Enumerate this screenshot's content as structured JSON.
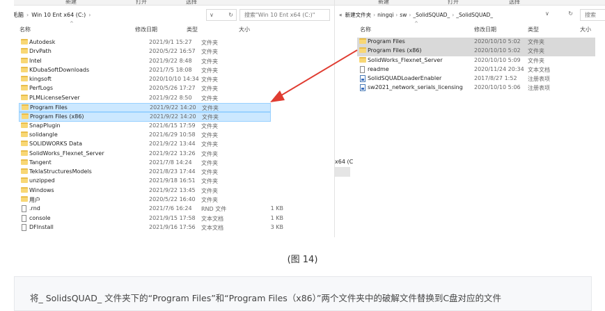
{
  "left": {
    "toolbar": [
      "新建",
      "打开",
      "选择"
    ],
    "address": [
      "毛脑",
      "Win 10 Ent x64 (C:)"
    ],
    "refresh_icon": "refresh-icon",
    "search_placeholder": "搜索\"Win 10 Ent x64 (C:)\"",
    "headers": {
      "name": "名称",
      "date": "修改日期",
      "type": "类型",
      "size": "大小"
    },
    "rows": [
      {
        "icon": "folder",
        "name": "Autodesk",
        "date": "2021/9/1 15:27",
        "type": "文件夹",
        "size": ""
      },
      {
        "icon": "folder",
        "name": "DrvPath",
        "date": "2020/5/22 16:57",
        "type": "文件夹",
        "size": ""
      },
      {
        "icon": "folder",
        "name": "Intel",
        "date": "2021/9/22 8:48",
        "type": "文件夹",
        "size": ""
      },
      {
        "icon": "folder",
        "name": "KDubaSoftDownloads",
        "date": "2021/7/5 18:08",
        "type": "文件夹",
        "size": ""
      },
      {
        "icon": "folder",
        "name": "kingsoft",
        "date": "2020/10/10 14:34",
        "type": "文件夹",
        "size": ""
      },
      {
        "icon": "folder",
        "name": "PerfLogs",
        "date": "2020/5/26 17:27",
        "type": "文件夹",
        "size": ""
      },
      {
        "icon": "folder",
        "name": "PLMLicenseServer",
        "date": "2021/9/22 8:50",
        "type": "文件夹",
        "size": ""
      },
      {
        "icon": "folder",
        "name": "Program Files",
        "date": "2021/9/22 14:20",
        "type": "文件夹",
        "size": "",
        "selected": true
      },
      {
        "icon": "folder",
        "name": "Program Files (x86)",
        "date": "2021/9/22 14:20",
        "type": "文件夹",
        "size": "",
        "selected": true
      },
      {
        "icon": "folder",
        "name": "SnapPlugin",
        "date": "2021/6/15 17:59",
        "type": "文件夹",
        "size": ""
      },
      {
        "icon": "folder",
        "name": "solidangle",
        "date": "2021/6/29 10:58",
        "type": "文件夹",
        "size": ""
      },
      {
        "icon": "folder",
        "name": "SOLIDWORKS Data",
        "date": "2021/9/22 13:44",
        "type": "文件夹",
        "size": ""
      },
      {
        "icon": "folder",
        "name": "SolidWorks_Flexnet_Server",
        "date": "2021/9/22 13:26",
        "type": "文件夹",
        "size": ""
      },
      {
        "icon": "folder",
        "name": "Tangent",
        "date": "2021/7/8 14:24",
        "type": "文件夹",
        "size": ""
      },
      {
        "icon": "folder",
        "name": "TeklaStructuresModels",
        "date": "2021/8/23 17:44",
        "type": "文件夹",
        "size": ""
      },
      {
        "icon": "folder",
        "name": "unzipped",
        "date": "2021/9/18 16:51",
        "type": "文件夹",
        "size": ""
      },
      {
        "icon": "folder",
        "name": "Windows",
        "date": "2021/9/22 13:45",
        "type": "文件夹",
        "size": ""
      },
      {
        "icon": "folder",
        "name": "用户",
        "date": "2020/5/22 16:40",
        "type": "文件夹",
        "size": ""
      },
      {
        "icon": "file",
        "name": ".rnd",
        "date": "2021/7/6 16:24",
        "type": "RND 文件",
        "size": "1 KB"
      },
      {
        "icon": "file",
        "name": "console",
        "date": "2021/9/15 17:58",
        "type": "文本文档",
        "size": "1 KB"
      },
      {
        "icon": "file",
        "name": "DFInstall",
        "date": "2021/9/16 17:56",
        "type": "文本文档",
        "size": "3 KB"
      }
    ]
  },
  "right": {
    "toolbar": [
      "新建",
      "打开",
      "选择"
    ],
    "address": [
      "«",
      "新建文件夹",
      "ningqi",
      "sw",
      "_SolidSQUAD_",
      "_SolidSQUAD_"
    ],
    "search_placeholder": "搜索",
    "headers": {
      "name": "名称",
      "date": "修改日期",
      "type": "类型",
      "size": "大小"
    },
    "peek_text": "x64 (C",
    "rows": [
      {
        "icon": "folder",
        "name": "Program Files",
        "date": "2020/10/10 5:02",
        "type": "文件夹",
        "selected": true
      },
      {
        "icon": "folder",
        "name": "Program Files (x86)",
        "date": "2020/10/10 5:02",
        "type": "文件夹",
        "selected": true
      },
      {
        "icon": "folder",
        "name": "SolidWorks_Flexnet_Server",
        "date": "2020/10/10 5:09",
        "type": "文件夹"
      },
      {
        "icon": "file",
        "name": "readme",
        "date": "2020/11/24 20:34",
        "type": "文本文档"
      },
      {
        "icon": "exe",
        "name": "SolidSQUADLoaderEnabler",
        "date": "2017/8/27 1:52",
        "type": "注册表项"
      },
      {
        "icon": "exe",
        "name": "sw2021_network_serials_licensing",
        "date": "2020/10/10 5:06",
        "type": "注册表项"
      }
    ]
  },
  "colors": {
    "selection": "#cce8ff",
    "arrow": "#e03c31"
  },
  "caption": "(图 14)",
  "note": "将_ SolidsQUAD_ 文件夹下的“Program Files”和“Program Files（x86）”两个文件夹中的破解文件替换到C盘对应的文件"
}
